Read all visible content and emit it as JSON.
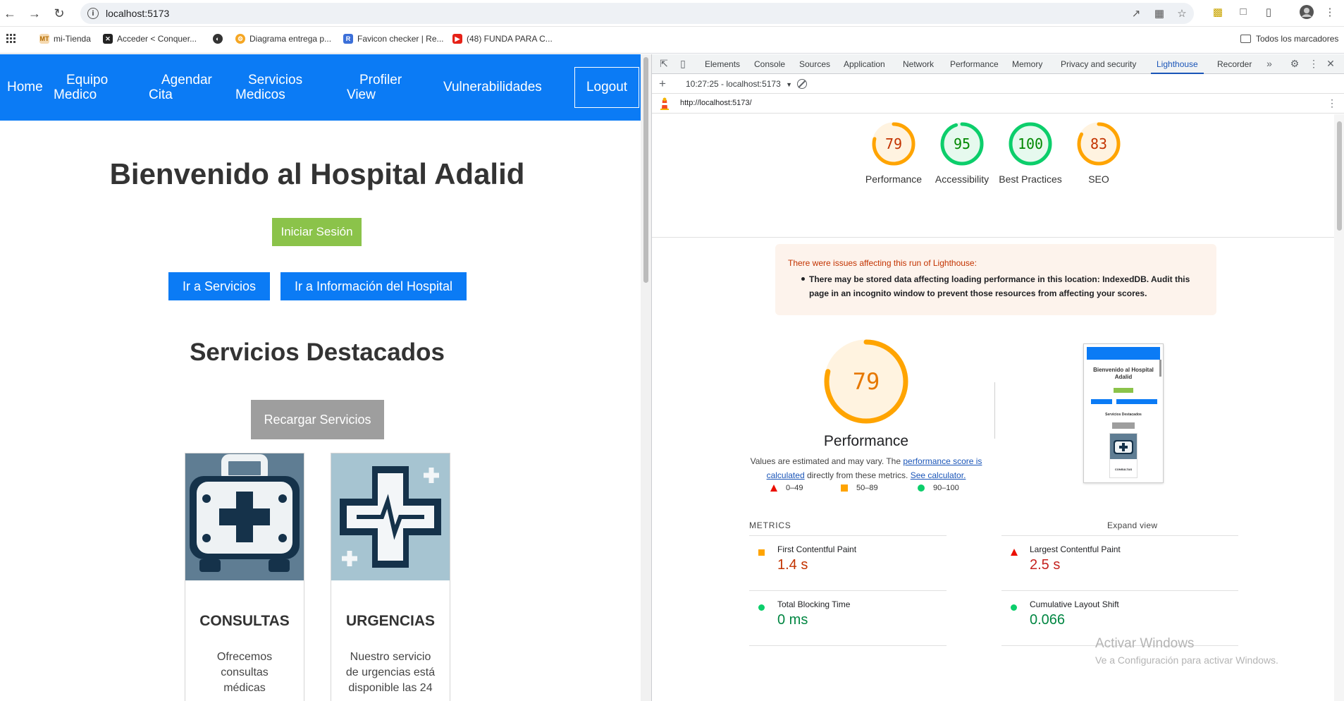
{
  "browser": {
    "url": "localhost:5173",
    "bookmarks": [
      "mi-Tienda",
      "Acceder < Conquer...",
      "Diagrama entrega p...",
      "Favicon checker | Re...",
      "(48) FUNDA PARA C..."
    ],
    "all_bookmarks": "Todos los marcadores"
  },
  "site": {
    "nav": {
      "home": "Home",
      "equipo_1": "Equipo",
      "equipo_2": "Medico",
      "agendar_1": "Agendar",
      "agendar_2": "Cita",
      "servicios_1": "Servicios",
      "servicios_2": "Medicos",
      "profiler_1": "Profiler",
      "profiler_2": "View",
      "vulnerabilidades": "Vulnerabilidades",
      "logout": "Logout"
    },
    "welcome": "Bienvenido al Hospital Adalid",
    "login_button": "Iniciar Sesión",
    "services_button": "Ir a Servicios",
    "info_button": "Ir a Información del Hospital",
    "featured_title": "Servicios Destacados",
    "reload_button": "Recargar Servicios",
    "cards": [
      {
        "title": "CONSULTAS",
        "desc_1": "Ofrecemos",
        "desc_2": "consultas",
        "desc_3": "médicas"
      },
      {
        "title": "URGENCIAS",
        "desc_1": "Nuestro servicio",
        "desc_2": "de urgencias está",
        "desc_3": "disponible las 24"
      }
    ]
  },
  "devtools": {
    "tabs": [
      "Elements",
      "Console",
      "Sources",
      "Application",
      "Network",
      "Performance",
      "Memory",
      "Privacy and security",
      "Lighthouse",
      "Recorder"
    ],
    "active_tab": "Lighthouse",
    "report_selector": "10:27:25 - localhost:5173",
    "report_url": "http://localhost:5173/",
    "scores": [
      {
        "label": "Performance",
        "value": 79,
        "color": "#ffa400"
      },
      {
        "label": "Accessibility",
        "value": 95,
        "color": "#0cce6b"
      },
      {
        "label": "Best Practices",
        "value": 100,
        "color": "#0cce6b"
      },
      {
        "label": "SEO",
        "value": 83,
        "color": "#ffa400"
      }
    ],
    "warning_title": "There were issues affecting this run of Lighthouse:",
    "warning_body": "There may be stored data affecting loading performance in this location: IndexedDB. Audit this page in an incognito window to prevent those resources from affecting your scores.",
    "perf_score": 79,
    "perf_title": "Performance",
    "perf_desc_1": "Values are estimated and may vary. The",
    "perf_desc_link1": "performance score is calculated",
    "perf_desc_2": "directly from these metrics.",
    "perf_desc_link2": "See calculator.",
    "legend": [
      "0–49",
      "50–89",
      "90–100"
    ],
    "metrics_heading": "METRICS",
    "expand_view": "Expand view",
    "metrics": [
      {
        "name": "First Contentful Paint",
        "value": "1.4 s",
        "status": "average"
      },
      {
        "name": "Largest Contentful Paint",
        "value": "2.5 s",
        "status": "fail"
      },
      {
        "name": "Total Blocking Time",
        "value": "0 ms",
        "status": "pass"
      },
      {
        "name": "Cumulative Layout Shift",
        "value": "0.066",
        "status": "pass"
      }
    ],
    "thumb_title_1": "Bienvenido al Hospital",
    "thumb_title_2": "Adalid",
    "thumb_subtitle": "Servicios Destacados",
    "thumb_card": "CONSULTAS"
  },
  "windows_watermark": {
    "line1": "Activar Windows",
    "line2": "Ve a Configuración para activar Windows."
  }
}
